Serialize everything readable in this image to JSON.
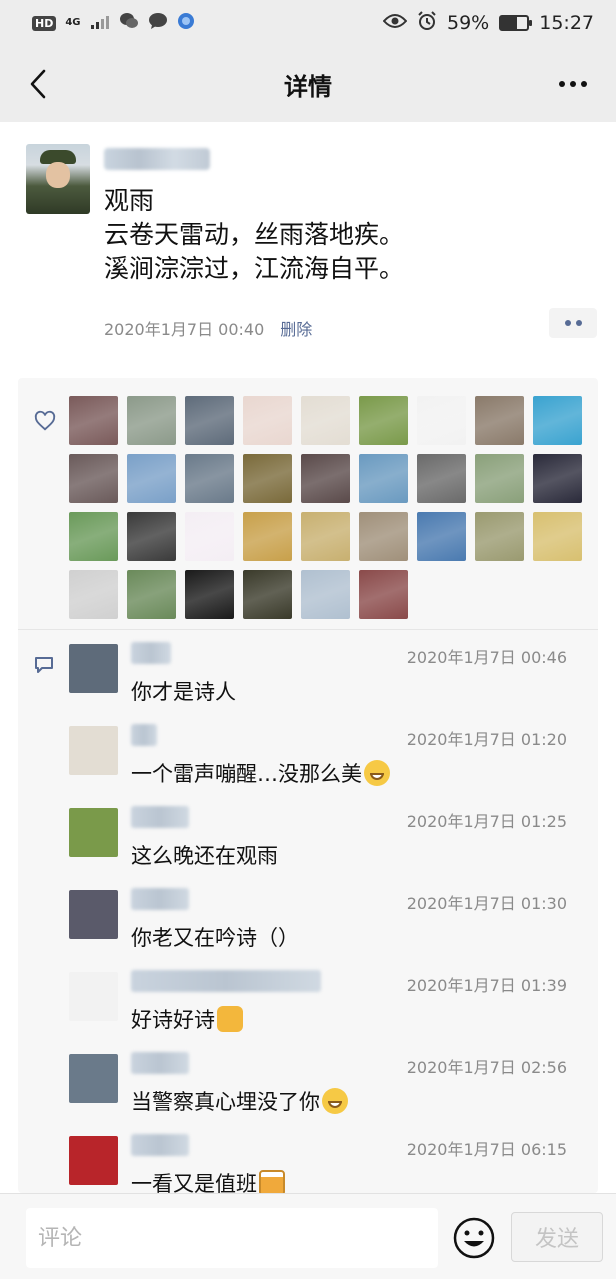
{
  "status_bar": {
    "hd": "HD",
    "network": "4G",
    "battery_percent": "59%",
    "battery_level": 0.59,
    "time": "15:27",
    "icons": [
      "wechat-icon",
      "message-icon",
      "app-icon",
      "eye-icon",
      "alarm-icon"
    ]
  },
  "nav": {
    "title": "详情",
    "back_icon": "chevron-left-icon",
    "more_icon": "more-dots-icon"
  },
  "post": {
    "lines": [
      "观雨",
      "云卷天雷动，丝雨落地疾。",
      "溪涧淙淙过，江流海自平。"
    ],
    "time": "2020年1月7日 00:40",
    "delete_label": "删除"
  },
  "likes": {
    "icon": "heart-outline-icon",
    "avatars": [
      "#7a5a5a",
      "#8c9a8a",
      "#5e6b7a",
      "#e9d7d0",
      "#e3ddd3",
      "#7a9a4a",
      "#f2f2f2",
      "#8a7a6a",
      "#3aa3d0",
      "#6a5a5a",
      "#7aa0c8",
      "#6a7a8a",
      "#7a6a3a",
      "#5a4a4a",
      "#6a9ac0",
      "#6a6a6a",
      "#8aa07a",
      "#2a2a3a",
      "#6a9a5a",
      "#3a3a3a",
      "#f4eef4",
      "#c8a04a",
      "#c8b070",
      "#a0907a",
      "#4a7ab0",
      "#9a9a70",
      "#d8c070",
      "#d0d0d0",
      "#6a8a5a",
      "#1a1a1a",
      "#3a3a2a",
      "#b0c0d0",
      "#8a4a4a"
    ]
  },
  "comments": {
    "icon": "comment-bubble-icon",
    "items": [
      {
        "time": "2020年1月7日 00:46",
        "text": "你才是诗人",
        "emoji": "",
        "avatar": "#5e6b7a",
        "name_w": 40
      },
      {
        "time": "2020年1月7日 01:20",
        "text": "一个雷声嘣醒…没那么美",
        "emoji": "laugh",
        "avatar": "#e3ddd3",
        "name_w": 26
      },
      {
        "time": "2020年1月7日 01:25",
        "text": "这么晚还在观雨",
        "emoji": "",
        "avatar": "#7a9a4a",
        "name_w": 58
      },
      {
        "time": "2020年1月7日 01:30",
        "text": "你老又在吟诗（）",
        "emoji": "",
        "avatar": "#5a5a6a",
        "name_w": 58
      },
      {
        "time": "2020年1月7日 01:39",
        "text": "好诗好诗",
        "emoji": "thumb",
        "avatar": "#f2f2f2",
        "name_w": 190
      },
      {
        "time": "2020年1月7日 02:56",
        "text": "当警察真心埋没了你",
        "emoji": "grin",
        "avatar": "#6a7a8a",
        "name_w": 58
      },
      {
        "time": "2020年1月7日 06:15",
        "text": "一看又是值班",
        "emoji": "beer",
        "avatar": "#b8252a",
        "name_w": 58
      }
    ]
  },
  "input": {
    "placeholder": "评论",
    "emoji_icon": "smiley-icon",
    "send_label": "发送"
  },
  "colors": {
    "link": "#576b95",
    "time": "#8a8a8a",
    "background": "#ededed"
  }
}
